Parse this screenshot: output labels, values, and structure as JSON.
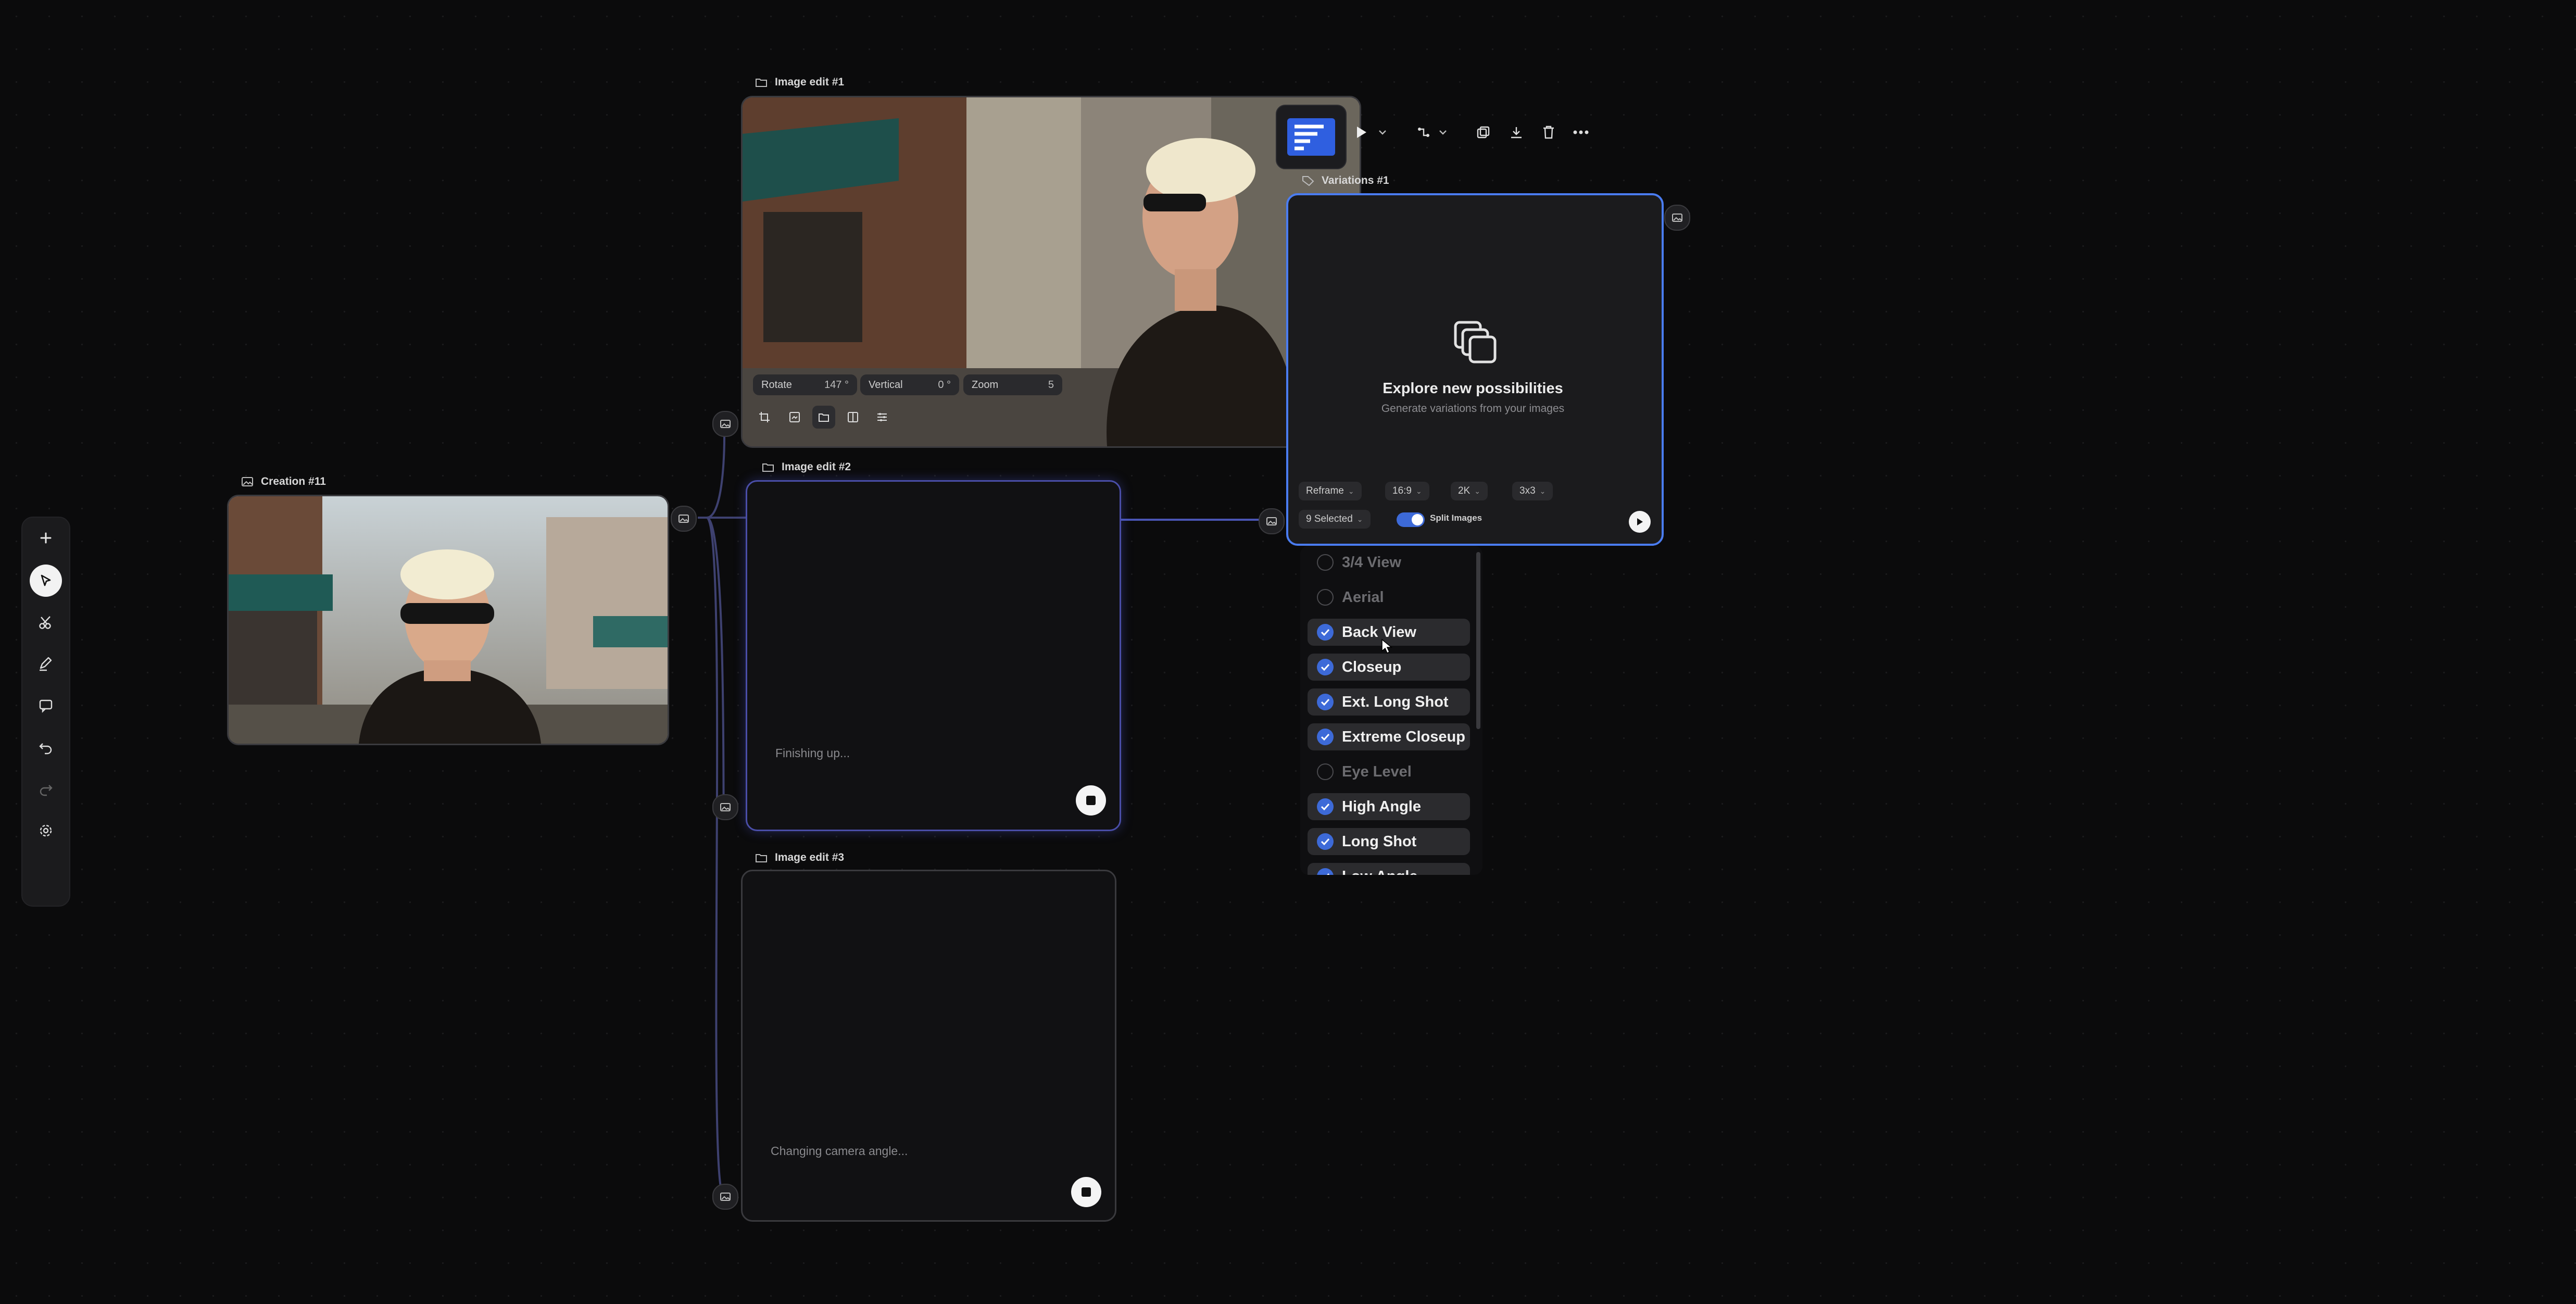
{
  "toolbar": {
    "icons": [
      "plus-icon",
      "select-icon",
      "cut-icon",
      "pen-icon",
      "comment-icon",
      "undo-icon",
      "redo-icon",
      "settings-icon"
    ]
  },
  "nodes": {
    "creation": {
      "title": "Creation #11"
    },
    "edit1": {
      "title": "Image edit #1",
      "controls": [
        {
          "label": "Rotate",
          "value": "147 °"
        },
        {
          "label": "Vertical",
          "value": "0 °"
        },
        {
          "label": "Zoom",
          "value": "5"
        }
      ]
    },
    "edit2": {
      "title": "Image edit #2",
      "status": "Finishing up..."
    },
    "edit3": {
      "title": "Image edit #3",
      "status": "Changing camera angle..."
    },
    "variations": {
      "title": "Variations #1",
      "heading": "Explore new possibilities",
      "subheading": "Generate variations from your images",
      "options": {
        "mode": "Reframe",
        "ratio": "16:9",
        "resolution": "2K",
        "grid": "3x3"
      },
      "selected_label": "9 Selected",
      "toggle_label": "Split Images",
      "toggle_on": true
    }
  },
  "dropdown": {
    "items": [
      {
        "label": "3/4 View",
        "checked": false
      },
      {
        "label": "Aerial",
        "checked": false
      },
      {
        "label": "Back View",
        "checked": true
      },
      {
        "label": "Closeup",
        "checked": true
      },
      {
        "label": "Ext. Long Shot",
        "checked": true
      },
      {
        "label": "Extreme Closeup",
        "checked": true
      },
      {
        "label": "Eye Level",
        "checked": false
      },
      {
        "label": "High Angle",
        "checked": true
      },
      {
        "label": "Long Shot",
        "checked": true
      },
      {
        "label": "Low Angle",
        "checked": true
      }
    ]
  },
  "colors": {
    "accent": "#3d6ad8",
    "selection": "#4a7cf0",
    "canvas": "#0b0b0c",
    "card": "#111113"
  }
}
